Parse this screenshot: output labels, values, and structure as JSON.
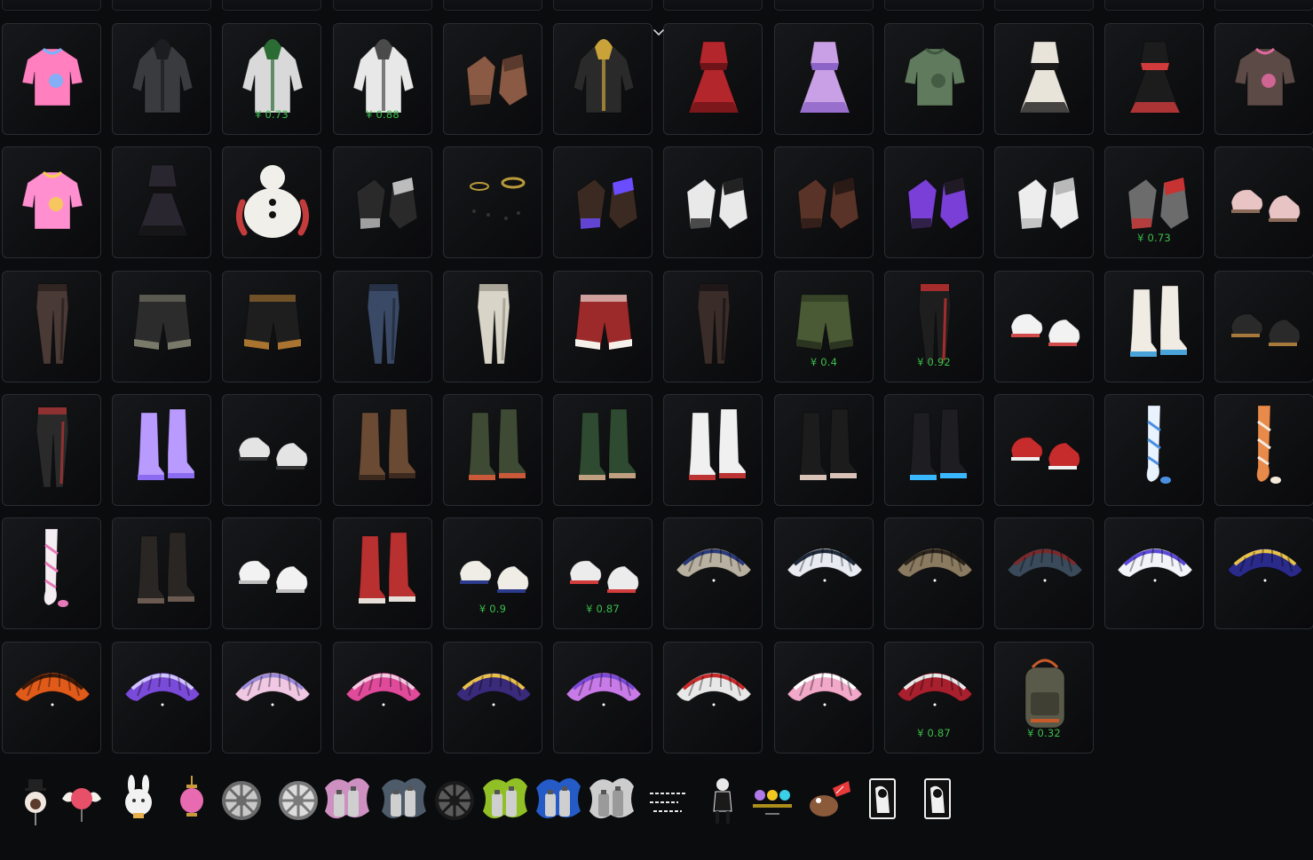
{
  "colors": {
    "background": "#0b0c0e",
    "tile_border": "#2a2c31",
    "price": "#3bbf4a"
  },
  "header": {
    "collapse_icon": "chevron-down-icon"
  },
  "inventory": {
    "rows": [
      [
        {
          "name": "hooded-scarf",
          "kind": "upper",
          "palette": [
            "#ff7fbf",
            "#6fb7ff"
          ],
          "price": ""
        },
        {
          "name": "dark-hooded-jacket",
          "kind": "jacket",
          "palette": [
            "#3a3b3f",
            "#1c1d20"
          ],
          "price": ""
        },
        {
          "name": "green-hooded-jacket",
          "kind": "jacket",
          "palette": [
            "#d9d9d9",
            "#2b6b34"
          ],
          "price": "¥ 0.73"
        },
        {
          "name": "white-hoodie",
          "kind": "jacket",
          "palette": [
            "#e8e8e8",
            "#4a4a4a"
          ],
          "price": "¥ 0.88"
        },
        {
          "name": "arm-wraps",
          "kind": "gloves",
          "palette": [
            "#8a5a44",
            "#5a3a2c"
          ],
          "price": ""
        },
        {
          "name": "gold-trim-jacket",
          "kind": "jacket",
          "palette": [
            "#2a2a2a",
            "#c9a23a"
          ],
          "price": ""
        },
        {
          "name": "red-dress",
          "kind": "dress",
          "palette": [
            "#b3262b",
            "#6e1418"
          ],
          "price": ""
        },
        {
          "name": "purple-kimono",
          "kind": "dress",
          "palette": [
            "#c9a0e6",
            "#8c63c7"
          ],
          "price": ""
        },
        {
          "name": "green-sweater",
          "kind": "upper",
          "palette": [
            "#5f7a5c",
            "#3f5740"
          ],
          "price": ""
        },
        {
          "name": "maid-outfit",
          "kind": "dress",
          "palette": [
            "#e9e4da",
            "#1b1b1b"
          ],
          "price": ""
        },
        {
          "name": "racer-top",
          "kind": "dress",
          "palette": [
            "#1c1c1c",
            "#d23b3b"
          ],
          "price": ""
        },
        {
          "name": "heart-tee",
          "kind": "upper",
          "palette": [
            "#5b4a45",
            "#e36aa0"
          ],
          "price": ""
        }
      ],
      [
        {
          "name": "pink-crop-top",
          "kind": "upper",
          "palette": [
            "#ff8fcf",
            "#f5d14a"
          ],
          "price": ""
        },
        {
          "name": "black-bodysuit",
          "kind": "dress",
          "palette": [
            "#2a2630",
            "#111"
          ],
          "price": ""
        },
        {
          "name": "snowman-suit",
          "kind": "snowman",
          "palette": [
            "#f1efe9",
            "#c33b3b"
          ],
          "price": ""
        },
        {
          "name": "skeleton-gloves",
          "kind": "gloves",
          "palette": [
            "#2a2a2a",
            "#bdbdbd"
          ],
          "price": ""
        },
        {
          "name": "gold-bracelets",
          "kind": "ring",
          "palette": [
            "#b89a3b",
            "#333"
          ],
          "price": ""
        },
        {
          "name": "purple-claw-gloves",
          "kind": "gloves",
          "palette": [
            "#3b2a22",
            "#6b4cff"
          ],
          "price": ""
        },
        {
          "name": "white-cuff-gloves",
          "kind": "gloves",
          "palette": [
            "#e9e9e9",
            "#222"
          ],
          "price": ""
        },
        {
          "name": "leather-gloves",
          "kind": "gloves",
          "palette": [
            "#5a3328",
            "#2a1a16"
          ],
          "price": ""
        },
        {
          "name": "purple-tactical-gloves",
          "kind": "gloves",
          "palette": [
            "#7a3fd6",
            "#1f1a24"
          ],
          "price": ""
        },
        {
          "name": "white-gloves",
          "kind": "gloves",
          "palette": [
            "#ededed",
            "#b9b9b9"
          ],
          "price": ""
        },
        {
          "name": "red-patch-gloves",
          "kind": "gloves",
          "palette": [
            "#6c6c6c",
            "#c73333"
          ],
          "price": "¥ 0.73"
        },
        {
          "name": "bunny-sneakers",
          "kind": "shoes",
          "palette": [
            "#e8c4c4",
            "#8a6b5a"
          ],
          "price": ""
        }
      ],
      [
        {
          "name": "stockings",
          "kind": "pants",
          "palette": [
            "#4a3a36",
            "#2a201e"
          ],
          "price": ""
        },
        {
          "name": "leather-shorts",
          "kind": "shorts",
          "palette": [
            "#2c2c2c",
            "#7a7a6a"
          ],
          "price": ""
        },
        {
          "name": "leopard-shorts",
          "kind": "shorts",
          "palette": [
            "#1e1e1e",
            "#a8742f"
          ],
          "price": ""
        },
        {
          "name": "plaid-skirt-jeans",
          "kind": "pants",
          "palette": [
            "#3a4a66",
            "#222b3d"
          ],
          "price": ""
        },
        {
          "name": "white-pants",
          "kind": "pants",
          "palette": [
            "#d8d4c8",
            "#9f9a8e"
          ],
          "price": ""
        },
        {
          "name": "santa-shorts",
          "kind": "shorts",
          "palette": [
            "#9c2a2a",
            "#f4f0ea"
          ],
          "price": ""
        },
        {
          "name": "strap-pants",
          "kind": "pants",
          "palette": [
            "#3a2c28",
            "#1a1414"
          ],
          "price": ""
        },
        {
          "name": "cargo-shorts",
          "kind": "shorts",
          "palette": [
            "#4a5a34",
            "#2a3420"
          ],
          "price": "¥ 0.4"
        },
        {
          "name": "red-stripe-pants",
          "kind": "pants",
          "palette": [
            "#1e1e1e",
            "#c63030"
          ],
          "price": "¥ 0.92"
        },
        {
          "name": "white-high-tops",
          "kind": "shoes",
          "palette": [
            "#f2f2f2",
            "#d14a4a"
          ],
          "price": ""
        },
        {
          "name": "floral-boots",
          "kind": "boots",
          "palette": [
            "#f0ece4",
            "#4aa3d8"
          ],
          "price": ""
        },
        {
          "name": "fur-sneakers",
          "kind": "shoes",
          "palette": [
            "#2a2a2a",
            "#a77a3c"
          ],
          "price": ""
        }
      ],
      [
        {
          "name": "strap-stockings",
          "kind": "pants",
          "palette": [
            "#2a2a2a",
            "#a33"
          ],
          "price": ""
        },
        {
          "name": "purple-platforms",
          "kind": "boots",
          "palette": [
            "#b99bff",
            "#8b6cf0"
          ],
          "price": ""
        },
        {
          "name": "white-loafers",
          "kind": "shoes",
          "palette": [
            "#e4e4e4",
            "#333"
          ],
          "price": ""
        },
        {
          "name": "brown-tall-boots",
          "kind": "boots",
          "palette": [
            "#6b4a34",
            "#3d2a1e"
          ],
          "price": ""
        },
        {
          "name": "wrap-boots",
          "kind": "boots",
          "palette": [
            "#3f4a34",
            "#c85a3a"
          ],
          "price": ""
        },
        {
          "name": "green-combat-boots",
          "kind": "boots",
          "palette": [
            "#2e4a30",
            "#c0a080"
          ],
          "price": ""
        },
        {
          "name": "white-leg-warmers",
          "kind": "boots",
          "palette": [
            "#f0f0f0",
            "#b33"
          ],
          "price": ""
        },
        {
          "name": "black-knee-boots",
          "kind": "boots",
          "palette": [
            "#1c1c1c",
            "#d9c2b8"
          ],
          "price": ""
        },
        {
          "name": "blue-sole-boots",
          "kind": "boots",
          "palette": [
            "#1d1d22",
            "#3ab8ff"
          ],
          "price": ""
        },
        {
          "name": "red-sneakers",
          "kind": "shoes",
          "palette": [
            "#c62c2c",
            "#efefef"
          ],
          "price": ""
        },
        {
          "name": "blue-ribbon-stockings",
          "kind": "stocking",
          "palette": [
            "#e9f2ff",
            "#4a8fe0"
          ],
          "price": ""
        },
        {
          "name": "orange-stockings",
          "kind": "stocking",
          "palette": [
            "#e88a4a",
            "#f5e9dc"
          ],
          "price": ""
        }
      ],
      [
        {
          "name": "pink-ribbon-stockings",
          "kind": "stocking",
          "palette": [
            "#f4eef2",
            "#e879b8"
          ],
          "price": ""
        },
        {
          "name": "studded-boots",
          "kind": "boots",
          "palette": [
            "#2a2624",
            "#6a5a50"
          ],
          "price": ""
        },
        {
          "name": "white-sneakers",
          "kind": "shoes",
          "palette": [
            "#f2f2f2",
            "#bfbfbf"
          ],
          "price": ""
        },
        {
          "name": "red-laced-boots",
          "kind": "boots",
          "palette": [
            "#b83030",
            "#e7e0d8"
          ],
          "price": ""
        },
        {
          "name": "gold-trim-sneakers",
          "kind": "shoes",
          "palette": [
            "#f0ede6",
            "#2b3a8a"
          ],
          "price": "¥ 0.9"
        },
        {
          "name": "red-sole-sneakers",
          "kind": "shoes",
          "palette": [
            "#ececec",
            "#d23c3c"
          ],
          "price": "¥ 0.87"
        },
        {
          "name": "parachute-striped",
          "kind": "parachute",
          "palette": [
            "#b8b0a0",
            "#2a3a7a"
          ],
          "price": ""
        },
        {
          "name": "parachute-road-king",
          "kind": "parachute",
          "palette": [
            "#e8ecf2",
            "#1f2a3a"
          ],
          "price": ""
        },
        {
          "name": "parachute-emblem",
          "kind": "parachute",
          "palette": [
            "#8a7a60",
            "#2a241c"
          ],
          "price": ""
        },
        {
          "name": "parachute-dark-print",
          "kind": "parachute",
          "palette": [
            "#3a4a5a",
            "#7a2a2a"
          ],
          "price": ""
        },
        {
          "name": "parachute-white-box",
          "kind": "parachute",
          "palette": [
            "#f2f4fa",
            "#5a4ad6"
          ],
          "price": ""
        },
        {
          "name": "parachute-blue-gold",
          "kind": "parachute",
          "palette": [
            "#2a2a8a",
            "#e8c24a"
          ],
          "price": ""
        }
      ],
      [
        {
          "name": "parachute-fire",
          "kind": "parachute",
          "palette": [
            "#e05a1a",
            "#3a1a0a"
          ],
          "price": ""
        },
        {
          "name": "parachute-purple-tag",
          "kind": "parachute",
          "palette": [
            "#7a4ad8",
            "#d0c4ff"
          ],
          "price": ""
        },
        {
          "name": "parachute-pastel",
          "kind": "parachute",
          "palette": [
            "#f0c8e4",
            "#9a8ad8"
          ],
          "price": ""
        },
        {
          "name": "parachute-pink-graffiti",
          "kind": "parachute",
          "palette": [
            "#e04a9a",
            "#f4c8e0"
          ],
          "price": ""
        },
        {
          "name": "parachute-cosmic",
          "kind": "parachute",
          "palette": [
            "#3a2a7a",
            "#e8c04a"
          ],
          "price": ""
        },
        {
          "name": "parachute-violet",
          "kind": "parachute",
          "palette": [
            "#c87ae8",
            "#7a4ad6"
          ],
          "price": ""
        },
        {
          "name": "parachute-red-white",
          "kind": "parachute",
          "palette": [
            "#e8e8e8",
            "#c82a2a"
          ],
          "price": ""
        },
        {
          "name": "parachute-pink-logo",
          "kind": "parachute",
          "palette": [
            "#f2a8c8",
            "#ffffff"
          ],
          "price": ""
        },
        {
          "name": "parachute-crimson",
          "kind": "parachute",
          "palette": [
            "#a8202e",
            "#e8e8e8"
          ],
          "price": "¥ 0.87"
        },
        {
          "name": "camo-backpack",
          "kind": "backpack",
          "palette": [
            "#5a5a4a",
            "#c85a2a"
          ],
          "price": "¥ 0.32"
        }
      ]
    ]
  },
  "trinkets": [
    {
      "name": "top-hat-charm",
      "kind": "charm",
      "palette": [
        "#f0e8e0",
        "#5a3a2a"
      ]
    },
    {
      "name": "winged-heart-charm",
      "kind": "wingheart",
      "palette": [
        "#e8506a",
        "#f4f0ea"
      ]
    },
    {
      "name": "bunny-charm",
      "kind": "bunny",
      "palette": [
        "#f2f2f2",
        "#e8b04a"
      ]
    },
    {
      "name": "pink-lantern-charm",
      "kind": "lantern",
      "palette": [
        "#e86ab0",
        "#c89a3a"
      ]
    },
    {
      "name": "silver-rim-1",
      "kind": "rim",
      "palette": [
        "#c8c8c8",
        "#6a6a6a"
      ]
    },
    {
      "name": "silver-rim-2",
      "kind": "rim",
      "palette": [
        "#dcdcdc",
        "#7a7a7a"
      ]
    },
    {
      "name": "pink-spray-paint",
      "kind": "spray",
      "palette": [
        "#f0a8e0",
        "#cfcfcf"
      ]
    },
    {
      "name": "dark-spray-paint",
      "kind": "spray",
      "palette": [
        "#5a6a7a",
        "#cfcfcf"
      ]
    },
    {
      "name": "black-rim",
      "kind": "rim",
      "palette": [
        "#5a5a5a",
        "#1a1a1a"
      ]
    },
    {
      "name": "lime-spray-paint",
      "kind": "spray",
      "palette": [
        "#a8e02a",
        "#cfcfcf"
      ]
    },
    {
      "name": "blue-spray-paint",
      "kind": "spray",
      "palette": [
        "#2a6ae8",
        "#cfcfcf"
      ]
    },
    {
      "name": "white-spray-paint",
      "kind": "spray",
      "palette": [
        "#f0f0f0",
        "#9a9a9a"
      ]
    },
    {
      "name": "japanese-text-emote",
      "kind": "text",
      "palette": [
        "#e8e8e8",
        "#111111"
      ]
    },
    {
      "name": "android-figure",
      "kind": "figure",
      "palette": [
        "#e8e8e8",
        "#1a1a1a"
      ]
    },
    {
      "name": "emoji-sticker",
      "kind": "emoji",
      "palette": [
        "#f0c820",
        "#3ad0e8"
      ]
    },
    {
      "name": "pet-with-tag",
      "kind": "pet",
      "palette": [
        "#8a5a3a",
        "#e83a3a"
      ]
    },
    {
      "name": "poster-card-1",
      "kind": "card",
      "palette": [
        "#f0f0f0",
        "#111111"
      ]
    },
    {
      "name": "poster-card-2",
      "kind": "card",
      "palette": [
        "#f0f0f0",
        "#111111"
      ]
    }
  ]
}
